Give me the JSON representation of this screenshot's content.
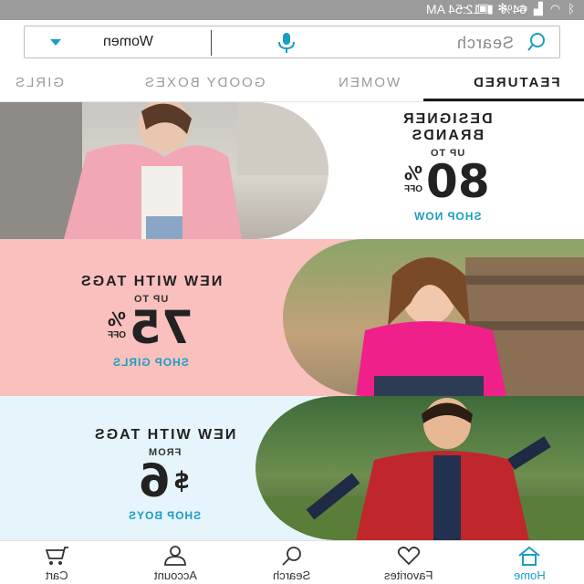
{
  "status_bar": {
    "time": "12:54 AM",
    "battery": "64%",
    "icons": [
      "bluetooth-icon",
      "wifi-icon",
      "signal-icon",
      "battery-icon",
      "alarm-icon",
      "fan-icon",
      "gallery-icon",
      "more-icon"
    ]
  },
  "search": {
    "placeholder": "Search",
    "department": "Women",
    "accent": "#1a9ec3"
  },
  "tabs": [
    {
      "label": "FEATURED",
      "active": true
    },
    {
      "label": "WOMEN",
      "active": false
    },
    {
      "label": "GOODY BOXES",
      "active": false
    },
    {
      "label": "GIRLS",
      "active": false
    }
  ],
  "banners": [
    {
      "headline": "DESIGNER\nBRANDS",
      "small": "UP TO",
      "number": "80",
      "percent": "%",
      "suffix": "OFF",
      "cta": "SHOP NOW",
      "background": "#ffffff"
    },
    {
      "headline": "NEW WITH TAGS",
      "small": "UP TO",
      "number": "75",
      "percent": "%",
      "suffix": "OFF",
      "cta": "SHOP GIRLS",
      "background": "#f9c0bd"
    },
    {
      "headline": "NEW WITH TAGS",
      "small": "FROM",
      "currency": "$",
      "number": "6",
      "cta": "SHOP BOYS",
      "background": "#e6f4fb"
    }
  ],
  "bottom_nav": [
    {
      "label": "Home",
      "icon": "home-icon",
      "active": true
    },
    {
      "label": "Favorites",
      "icon": "heart-icon",
      "active": false
    },
    {
      "label": "Search",
      "icon": "search-icon",
      "active": false
    },
    {
      "label": "Account",
      "icon": "person-icon",
      "active": false
    },
    {
      "label": "Cart",
      "icon": "cart-icon",
      "active": false
    }
  ]
}
